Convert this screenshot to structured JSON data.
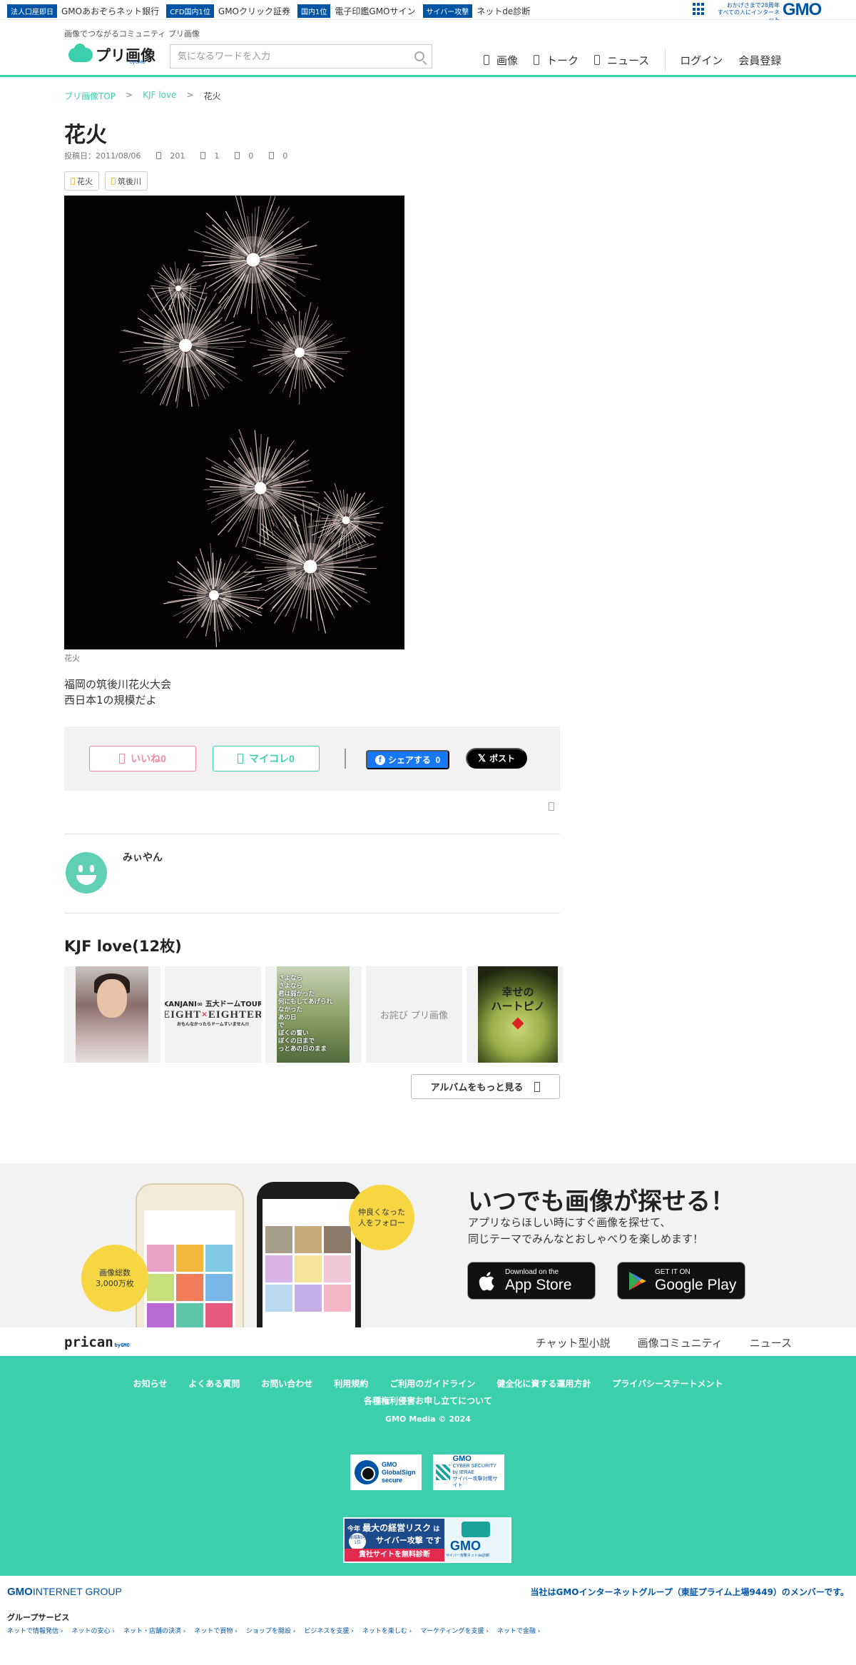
{
  "gmo_bar": {
    "items": [
      {
        "badge": "法人口座即日",
        "label": "GMOあおぞらネット銀行"
      },
      {
        "badge": "CFD国内1位",
        "label": "GMOクリック証券"
      },
      {
        "badge": "国内1位",
        "label": "電子印鑑GMOサイン"
      },
      {
        "badge": "サイバー攻撃",
        "label": "ネットde診断"
      }
    ],
    "anniversary_line1": "おかげさまで28周年",
    "anniversary_line2": "すべての人にインターネット",
    "logo": "GMO"
  },
  "header": {
    "tagline": "画像でつながるコミュニティ プリ画像",
    "brand": "プリ画像",
    "brand_sub": "byGMO",
    "search_placeholder": "気になるワードを入力",
    "nav": [
      "画像",
      "トーク",
      "ニュース"
    ],
    "login": "ログイン",
    "signup": "会員登録"
  },
  "breadcrumb": [
    "プリ画像TOP",
    "KJF love",
    "花火"
  ],
  "post": {
    "title": "花火",
    "posted_date": "投稿日：2011/08/06",
    "views": "201",
    "likes": "1",
    "collects": "0",
    "comments": "0",
    "tags": [
      "花火",
      "筑後川"
    ],
    "caption": "花火",
    "description": [
      "福岡の筑後川花火大会",
      "西日本1の規模だよ"
    ]
  },
  "actions": {
    "like": "いいね",
    "like_count": "0",
    "mycolle": "マイコレ",
    "mycolle_count": "0",
    "fb_share": "シェアする",
    "fb_count": "0",
    "x_post": "ポスト"
  },
  "user": {
    "name": "みぃやん"
  },
  "album": {
    "title": "KJF love(12枚)",
    "thumb2_line1": "KANJANI∞ 五大ドームTOUR",
    "thumb2_line2_a": "EIGHT",
    "thumb2_line2_x": "×",
    "thumb2_line2_b": "EIGHTER",
    "thumb2_line3": "おもんなかったらドームすいません!!",
    "thumb3_poem": [
      "さよなら",
      "さよなら",
      "君は弱かった",
      "何にもしてあげられ",
      "なかった",
      "あの日",
      "で",
      "ぼくの誓い",
      "ぼくの日まで",
      "っとあの日のまま"
    ],
    "thumb4_alt": "お詫び プリ画像",
    "thumb5_text": [
      "幸せの",
      "ハートピノ"
    ],
    "more": "アルバムをもっと見る"
  },
  "promo": {
    "circle1": [
      "画像総数",
      "3,000万枚"
    ],
    "circle2": [
      "仲良くなった",
      "人をフォロー"
    ],
    "title": "いつでも画像が探せる！",
    "sub1": "アプリならほしい時にすぐ画像を探せて、",
    "sub2": "同じテーマでみんなとおしゃべりを楽しめます！",
    "apple_small": "Download on the",
    "apple_large": "App Store",
    "google_small": "GET IT ON",
    "google_large": "Google Play"
  },
  "prican": {
    "logo": "prican",
    "logo_sub": "byGMO",
    "links": [
      "チャット型小説",
      "画像コミュニティ",
      "ニュース"
    ]
  },
  "footer": {
    "links": [
      "お知らせ",
      "よくある質問",
      "お問い合わせ",
      "利用規約",
      "ご利用のガイドライン",
      "健全化に資する運用方針",
      "プライバシーステートメント"
    ],
    "link2": "各種権利侵害お申し立てについて",
    "copyright": "GMO Media © 2024",
    "seal1": [
      "GMO",
      "GlobalSign",
      "secure"
    ],
    "seal2": [
      "GMO",
      "CYBER SECURITY",
      "by IERAE",
      "サイバー攻撃対策サイト"
    ],
    "banner_l1_a": "今年",
    "banner_l1_b": "最大の経営リスク",
    "banner_l1_c": "は",
    "banner_rank": [
      "脅威動向",
      "1位"
    ],
    "banner_l2": "サイバー攻撃 です",
    "banner_l3": "貴社サイトを無料診断",
    "banner_logo": "GMO",
    "banner_cap": "サイバー攻撃ネットde診断"
  },
  "group": {
    "logo_a": "GMO",
    "logo_b": "INTERNET GROUP",
    "member": "当社はGMOインターネットグループ（東証プライム上場9449）のメンバーです。",
    "services_title": "グループサービス",
    "services": [
      "ネットで情報発信 ›",
      "ネットの安心 ›",
      "ネット・店舗の決済 ›",
      "ネットで買物 ›",
      "ショップを開設 ›",
      "ビジネスを支援 ›",
      "ネットを楽しむ ›",
      "マーケティングを支援 ›",
      "ネットで金融 ›"
    ]
  },
  "colors": {
    "accent": "#3ccfae",
    "gmo_blue": "#0054a6",
    "like_pink": "#f08aa6",
    "promo_yellow": "#f6d743"
  }
}
